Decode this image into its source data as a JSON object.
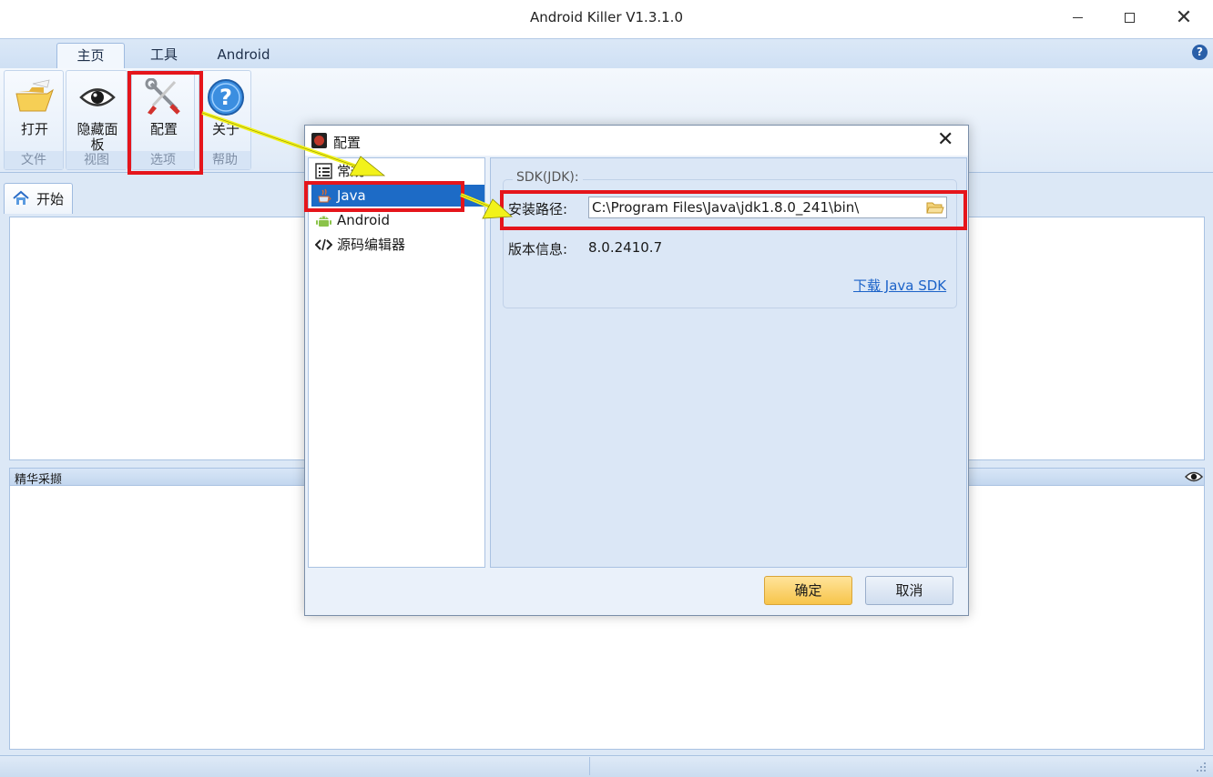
{
  "window": {
    "title": "Android Killer V1.3.1.0",
    "close_glyph": "✕"
  },
  "ribbon": {
    "tabs": [
      {
        "label": "主页"
      },
      {
        "label": "工具"
      },
      {
        "label": "Android"
      }
    ],
    "help_glyph": "?",
    "groups": [
      {
        "label": "文件",
        "buttons": [
          {
            "label": "打开",
            "icon": "folder-open-icon"
          }
        ]
      },
      {
        "label": "视图",
        "buttons": [
          {
            "label": "隐藏面板",
            "icon": "eye-icon"
          }
        ]
      },
      {
        "label": "选项",
        "buttons": [
          {
            "label": "配置",
            "icon": "tools-icon"
          }
        ]
      },
      {
        "label": "帮助",
        "buttons": [
          {
            "label": "关于",
            "icon": "help-icon"
          }
        ]
      }
    ]
  },
  "workspace": {
    "start_tab": "开始",
    "panel_header": "精华采撷"
  },
  "dialog": {
    "title": "配置",
    "close_glyph": "✕",
    "nav": [
      {
        "label": "常规",
        "icon": "list-icon"
      },
      {
        "label": "Java",
        "icon": "java-icon"
      },
      {
        "label": "Android",
        "icon": "android-icon"
      },
      {
        "label": "源码编辑器",
        "icon": "code-icon"
      }
    ],
    "sdk": {
      "legend": "SDK(JDK):",
      "path_label": "安装路径:",
      "path_value": "C:\\Program Files\\Java\\jdk1.8.0_241\\bin\\",
      "version_label": "版本信息:",
      "version_value": "8.0.2410.7",
      "download_link": "下载 Java SDK"
    },
    "buttons": {
      "ok": "确定",
      "cancel": "取消"
    }
  },
  "colors": {
    "annotation": "#e5151b",
    "arrow": "#f2f21a",
    "selection": "#1d6bc6"
  }
}
